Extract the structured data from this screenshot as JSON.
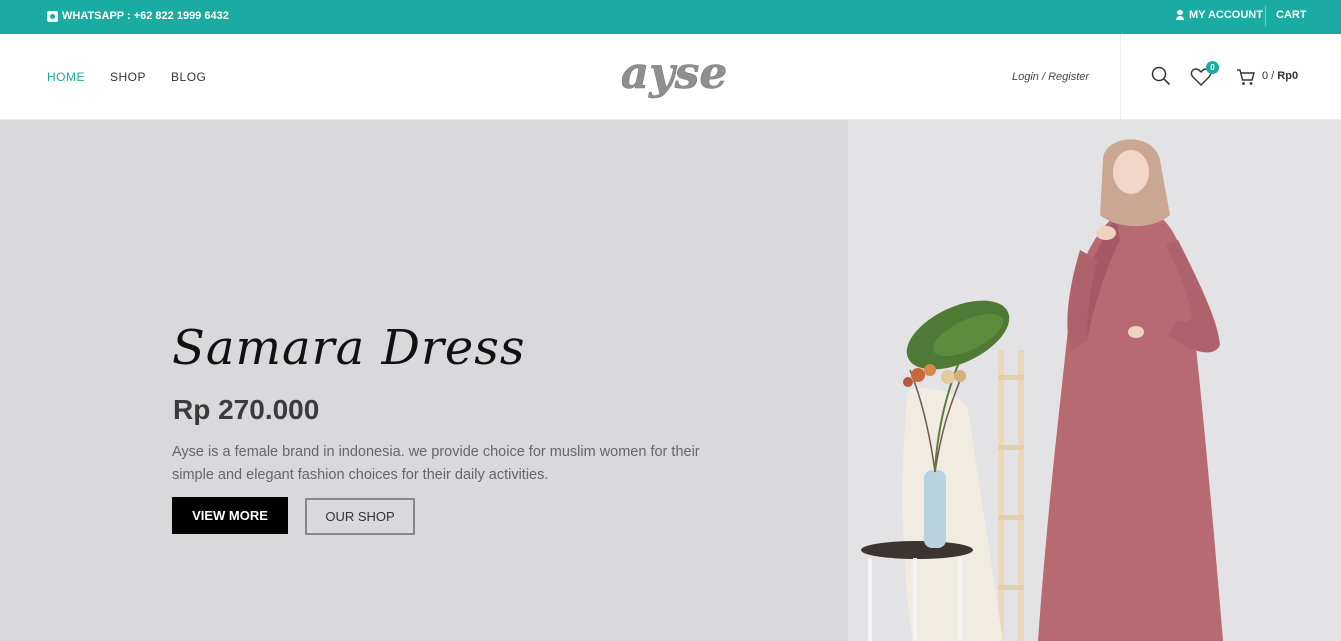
{
  "topbar": {
    "whatsapp": "WHATSAPP : +62 822 1999 6432",
    "my_account": "MY ACCOUNT",
    "cart": "CART"
  },
  "header": {
    "nav": [
      {
        "label": "HOME",
        "active": true
      },
      {
        "label": "SHOP",
        "active": false
      },
      {
        "label": "BLOG",
        "active": false
      }
    ],
    "logo_text": "ayse",
    "login_register": "Login / Register",
    "wishlist_count": "0",
    "cart_count": "0 /",
    "cart_amount": "Rp0"
  },
  "hero": {
    "title": "Samara Dress",
    "price": "Rp 270.000",
    "description": "Ayse is a female brand in indonesia. we provide choice for muslim women for their simple and elegant fashion choices for their daily activities.",
    "view_more": "VIEW MORE",
    "our_shop": "OUR SHOP"
  },
  "colors": {
    "accent": "#1aaba3",
    "hero_bg": "#d9d8db",
    "dress": "#b86a73"
  },
  "icons": [
    "phone-icon",
    "user-icon",
    "search-icon",
    "heart-icon",
    "cart-icon"
  ]
}
